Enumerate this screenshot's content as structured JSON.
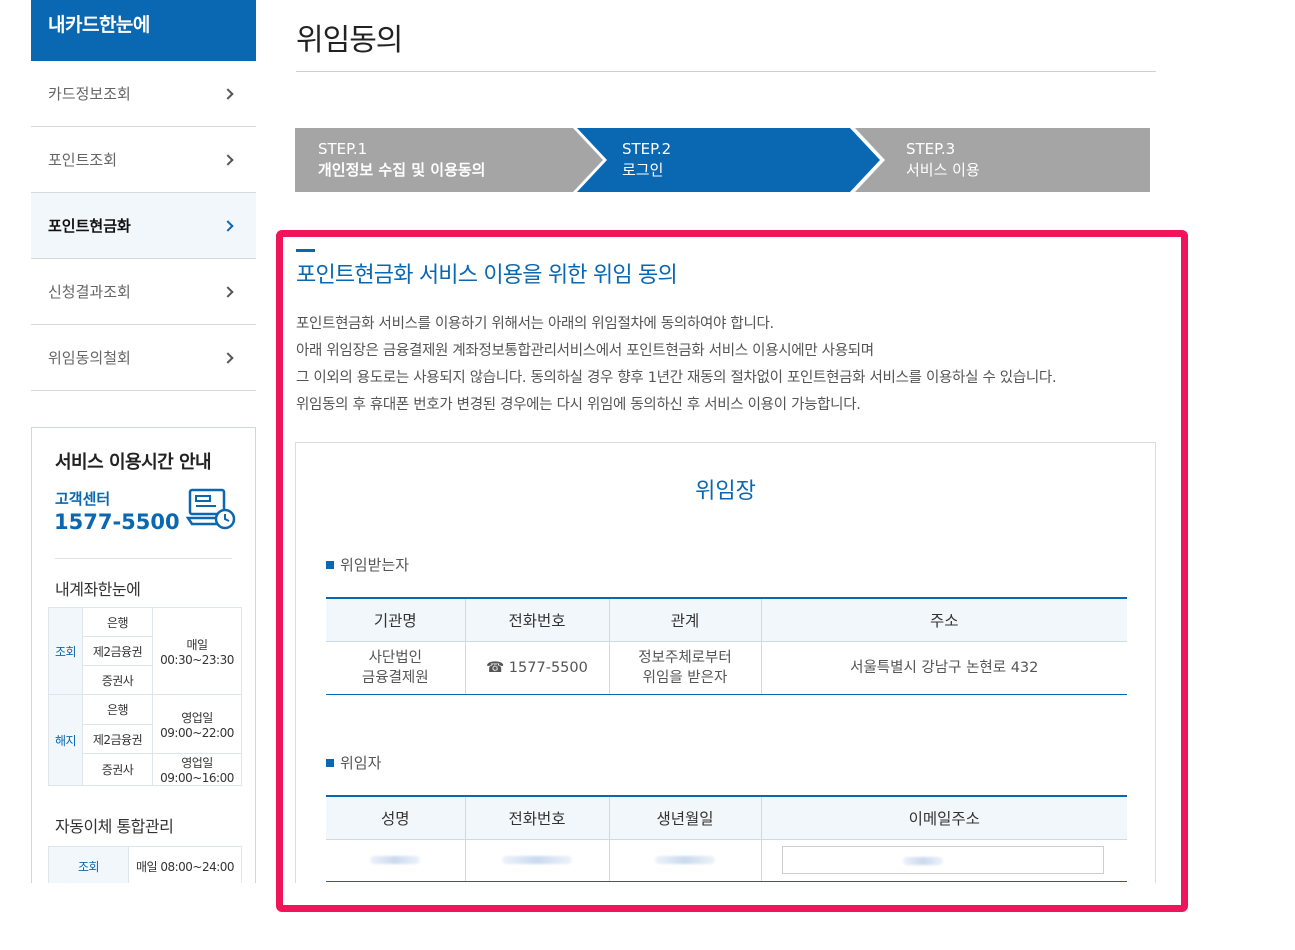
{
  "sidebar": {
    "header": "내카드한눈에",
    "items": [
      {
        "label": "카드정보조회",
        "active": false
      },
      {
        "label": "포인트조회",
        "active": false
      },
      {
        "label": "포인트현금화",
        "active": true
      },
      {
        "label": "신청결과조회",
        "active": false
      },
      {
        "label": "위임동의철회",
        "active": false
      }
    ]
  },
  "service_box": {
    "title": "서비스 이용시간 안내",
    "call_center_label": "고객센터",
    "call_center_number": "1577-5500",
    "icon": "customer-center-icon",
    "account_section_title": "내계좌한눈에",
    "account_rows": {
      "inquiry_label": "조회",
      "cancel_label": "해지",
      "bank": "은행",
      "second_finance": "제2금융권",
      "securities": "증권사",
      "inquiry_daily": "매일",
      "inquiry_hours": "00:30~23:30",
      "cancel_weekday": "영업일",
      "cancel_hours_1": "09:00~22:00",
      "cancel_hours_2": "09:00~16:00"
    },
    "autotransfer_title": "자동이체 통합관리",
    "autotransfer_inquiry_label": "조회",
    "autotransfer_hours": "매일 08:00~24:00"
  },
  "main": {
    "page_title": "위임동의",
    "steps": [
      {
        "num": "STEP.1",
        "label": "개인정보 수집 및 이용동의",
        "active": false
      },
      {
        "num": "STEP.2",
        "label": "로그인",
        "active": true
      },
      {
        "num": "STEP.3",
        "label": "서비스 이용",
        "active": false
      }
    ],
    "section_title": "포인트현금화 서비스 이용을 위한 위임 동의",
    "intro_lines": [
      "포인트현금화 서비스를 이용하기 위해서는 아래의 위임절차에 동의하여야 합니다.",
      "아래 위임장은 금융결제원 계좌정보통합관리서비스에서 포인트현금화 서비스 이용시에만 사용되며",
      "그 이외의 용도로는 사용되지 않습니다. 동의하실 경우 향후 1년간 재동의 절차없이 포인트현금화 서비스를 이용하실 수 있습니다.",
      "위임동의 후 휴대폰 번호가 변경된 경우에는 다시 위임에 동의하신 후 서비스 이용이 가능합니다."
    ],
    "document": {
      "title": "위임장",
      "grantee_label": "위임받는자",
      "grantee_headers": [
        "기관명",
        "전화번호",
        "관계",
        "주소"
      ],
      "grantee_row": {
        "org_line1": "사단법인",
        "org_line2": "금융결제원",
        "phone": "☎ 1577-5500",
        "relation_line1": "정보주체로부터",
        "relation_line2": "위임을 받은자",
        "address": "서울특별시 강남구 논현로 432"
      },
      "grantor_label": "위임자",
      "grantor_headers": [
        "성명",
        "전화번호",
        "생년월일",
        "이메일주소"
      ]
    }
  },
  "colors": {
    "accent": "#0a67b1",
    "step_inactive": "#a5a5a5",
    "highlight_frame": "#f0145a"
  }
}
